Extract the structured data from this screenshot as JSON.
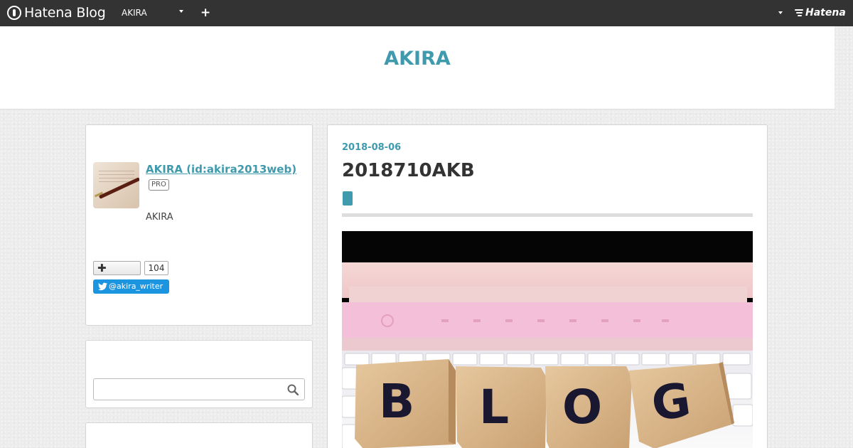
{
  "global_header": {
    "logo_text": "Hatena Blog",
    "blog_name": "AKIRA",
    "add_label": "+",
    "hatena_text": "Hatena"
  },
  "blog": {
    "title": "AKIRA"
  },
  "sidebar": {
    "profile": {
      "name": "AKIRA (id:akira2013web)",
      "badge": "PRO",
      "description": "AKIRA",
      "follow_count": "104",
      "twitter_handle": "@akira_writer"
    },
    "search": {
      "placeholder": ""
    }
  },
  "entry": {
    "date": "2018-08-06",
    "title": "2018710AKB",
    "image_letters": [
      "B",
      "L",
      "O",
      "G"
    ]
  },
  "colors": {
    "accent": "#3f9aae",
    "header_bg": "#333333",
    "twitter": "#1b95e0"
  }
}
